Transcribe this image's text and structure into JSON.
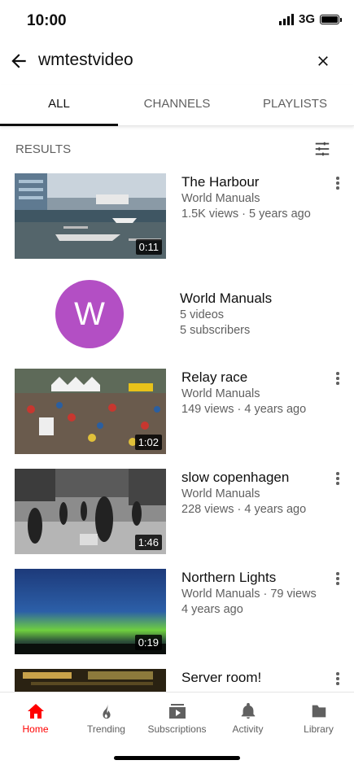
{
  "status": {
    "time": "10:00",
    "network": "3G"
  },
  "search": {
    "query": "wmtestvideo"
  },
  "tabs": [
    {
      "label": "ALL"
    },
    {
      "label": "CHANNELS"
    },
    {
      "label": "PLAYLISTS"
    }
  ],
  "results_label": "RESULTS",
  "videos": [
    {
      "title": "The Harbour",
      "channel": "World Manuals",
      "stats": "1.5K views · 5 years ago",
      "duration": "0:11"
    },
    {
      "title": "Relay race",
      "channel": "World Manuals",
      "stats": "149 views · 4 years ago",
      "duration": "1:02"
    },
    {
      "title": "slow copenhagen",
      "channel": "World Manuals",
      "stats": "228 views · 4 years ago",
      "duration": "1:46"
    },
    {
      "title": "Northern Lights",
      "channel": "World Manuals · 79 views",
      "stats": "4 years ago",
      "duration": "0:19"
    },
    {
      "title": "Server room!"
    }
  ],
  "channel": {
    "initial": "W",
    "name": "World Manuals",
    "videos": "5 videos",
    "subscribers": "5 subscribers",
    "color": "#b34fc4"
  },
  "nav": [
    {
      "label": "Home",
      "icon": "home-icon"
    },
    {
      "label": "Trending",
      "icon": "flame-icon"
    },
    {
      "label": "Subscriptions",
      "icon": "subscriptions-icon"
    },
    {
      "label": "Activity",
      "icon": "bell-icon"
    },
    {
      "label": "Library",
      "icon": "folder-icon"
    }
  ],
  "colors": {
    "accent": "#ff0000",
    "text_secondary": "#606060"
  }
}
